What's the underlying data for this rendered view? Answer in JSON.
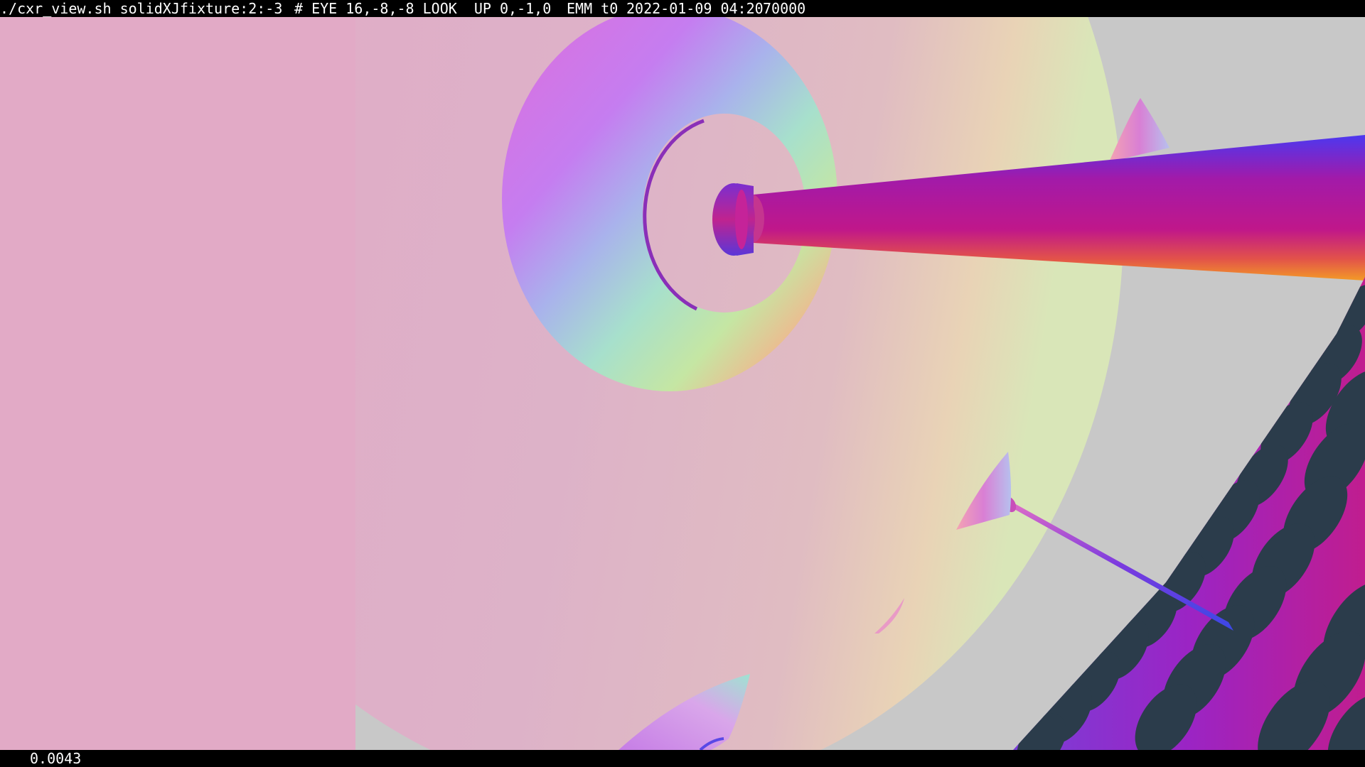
{
  "window": {
    "command": "./cxr_view.sh solidXJfixture:2:-3",
    "camera": "# EYE 16,-8,-8 LOOK  UP 0,-1,0",
    "mode": "EMM t0",
    "datetime": "2022-01-09 04:20",
    "count": "70000"
  },
  "status": {
    "frame_time": "0.0043"
  },
  "colors": {
    "background": "#c8c8c8",
    "hud_background": "#000000",
    "hud_text": "#ffffff",
    "large_disc_pink": "#e6a8c4",
    "disc_magenta": "#d86fd8",
    "disc_violet": "#b78af0",
    "disc_cyan": "#a6d9d9",
    "disc_green": "#b5e6a9",
    "disc_peach": "#f7a28c",
    "rod_magenta": "#b3179b",
    "rod_blue": "#5b36f2",
    "rod_orange": "#f07e2c",
    "panel_purple": "#8b2fd6",
    "panel_dark_ellipse": "#2d3f4c"
  },
  "icons": {
    "scene": "3d-geometry-render"
  }
}
